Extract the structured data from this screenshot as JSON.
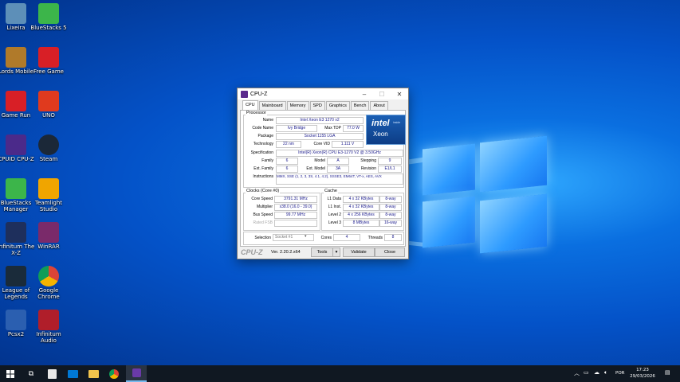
{
  "desktop": {
    "icons": [
      {
        "label": "Lixeira",
        "icon": "recycle-bin-icon",
        "color": "#5d8fb8"
      },
      {
        "label": "BlueStacks 5",
        "icon": "bluestacks-icon",
        "color": "#3cb54a"
      },
      {
        "label": "Lords Mobile",
        "icon": "lords-mobile-icon",
        "color": "#b07a2a"
      },
      {
        "label": "Free Game",
        "icon": "free-game-icon",
        "color": "#d81f26"
      },
      {
        "label": "Game Run",
        "icon": "game-run-icon",
        "color": "#d81f26"
      },
      {
        "label": "UNO",
        "icon": "uno-icon",
        "color": "#e03a1e"
      },
      {
        "label": "CPUID CPU-Z",
        "icon": "cpuz-icon",
        "color": "#4b2a8a"
      },
      {
        "label": "Steam",
        "icon": "steam-icon",
        "color": "#1b2838"
      },
      {
        "label": "BlueStacks Manager",
        "icon": "bluestacks-manager-icon",
        "color": "#3cb54a"
      },
      {
        "label": "Teamlight Studio",
        "icon": "teamlight-icon",
        "color": "#f0a500"
      },
      {
        "label": "Infinitum The X-Z",
        "icon": "nz-icon",
        "color": "#1e2f5c"
      },
      {
        "label": "WinRAR",
        "icon": "winrar-icon",
        "color": "#7a2a6a"
      },
      {
        "label": "League of Legends",
        "icon": "league-of-legends-icon",
        "color": "#1a2b3a"
      },
      {
        "label": "Google Chrome",
        "icon": "chrome-icon",
        "color": "#ffffff"
      },
      {
        "label": "Pcsx2",
        "icon": "pcsx2-icon",
        "color": "#2b5fb0"
      },
      {
        "label": "Infinitum Audio",
        "icon": "audio-icon",
        "color": "#b01e2a"
      }
    ]
  },
  "cpuz": {
    "title": "CPU-Z",
    "tabs": [
      "CPU",
      "Mainboard",
      "Memory",
      "SPD",
      "Graphics",
      "Bench",
      "About"
    ],
    "active_tab": "CPU",
    "processor": {
      "group_label": "Processor",
      "name_label": "Name",
      "name": "Intel Xeon E3 1270 v2",
      "codename_label": "Code Name",
      "codename": "Ivy Bridge",
      "maxtdp_label": "Max TDP",
      "maxtdp": "77.0 W",
      "package_label": "Package",
      "package": "Socket 1155 LGA",
      "technology_label": "Technology",
      "technology": "22 nm",
      "corevid_label": "Core VID",
      "corevid": "1.111 V",
      "spec_label": "Specification",
      "spec": "Intel(R) Xeon(R) CPU E3-1270 V2 @ 3.50GHz",
      "family_label": "Family",
      "family": "6",
      "model_label": "Model",
      "model": "A",
      "stepping_label": "Stepping",
      "stepping": "9",
      "extfamily_label": "Ext. Family",
      "extfamily": "6",
      "extmodel_label": "Ext. Model",
      "extmodel": "3A",
      "revision_label": "Revision",
      "revision": "E1/L1",
      "instructions_label": "Instructions",
      "instructions": "MMX, SSE (1, 2, 3, 3S, 4.1, 4.2), SSSE3, EM64T, VT-x, AES, AVX"
    },
    "intel_badge": {
      "brand": "intel",
      "sub": "inside",
      "line": "Xeon"
    },
    "clocks": {
      "group_label": "Clocks (Core #0)",
      "corespeed_label": "Core Speed",
      "corespeed": "3791.31 MHz",
      "multiplier_label": "Multiplier",
      "multiplier": "x38.0 (16.0 - 39.0)",
      "busspeed_label": "Bus Speed",
      "busspeed": "99.77 MHz",
      "ratedfsb_label": "Rated FSB",
      "ratedfsb": ""
    },
    "cache": {
      "group_label": "Cache",
      "rows": [
        {
          "label": "L1 Data",
          "size": "4 x 32 KBytes",
          "ways": "8-way"
        },
        {
          "label": "L1 Inst.",
          "size": "4 x 32 KBytes",
          "ways": "8-way"
        },
        {
          "label": "Level 2",
          "size": "4 x 256 KBytes",
          "ways": "8-way"
        },
        {
          "label": "Level 3",
          "size": "8 MBytes",
          "ways": "16-way"
        }
      ]
    },
    "selection": {
      "label": "Selection",
      "value": "Socket #1",
      "cores_label": "Cores",
      "cores": "4",
      "threads_label": "Threads",
      "threads": "8"
    },
    "footer": {
      "brand": "CPU-Z",
      "version": "Ver. 2.20.2.x64",
      "tools_label": "Tools",
      "validate_label": "Validate",
      "close_label": "Close"
    }
  },
  "taskbar": {
    "language": "POR",
    "time": "17:23",
    "date": "29/03/2026"
  }
}
